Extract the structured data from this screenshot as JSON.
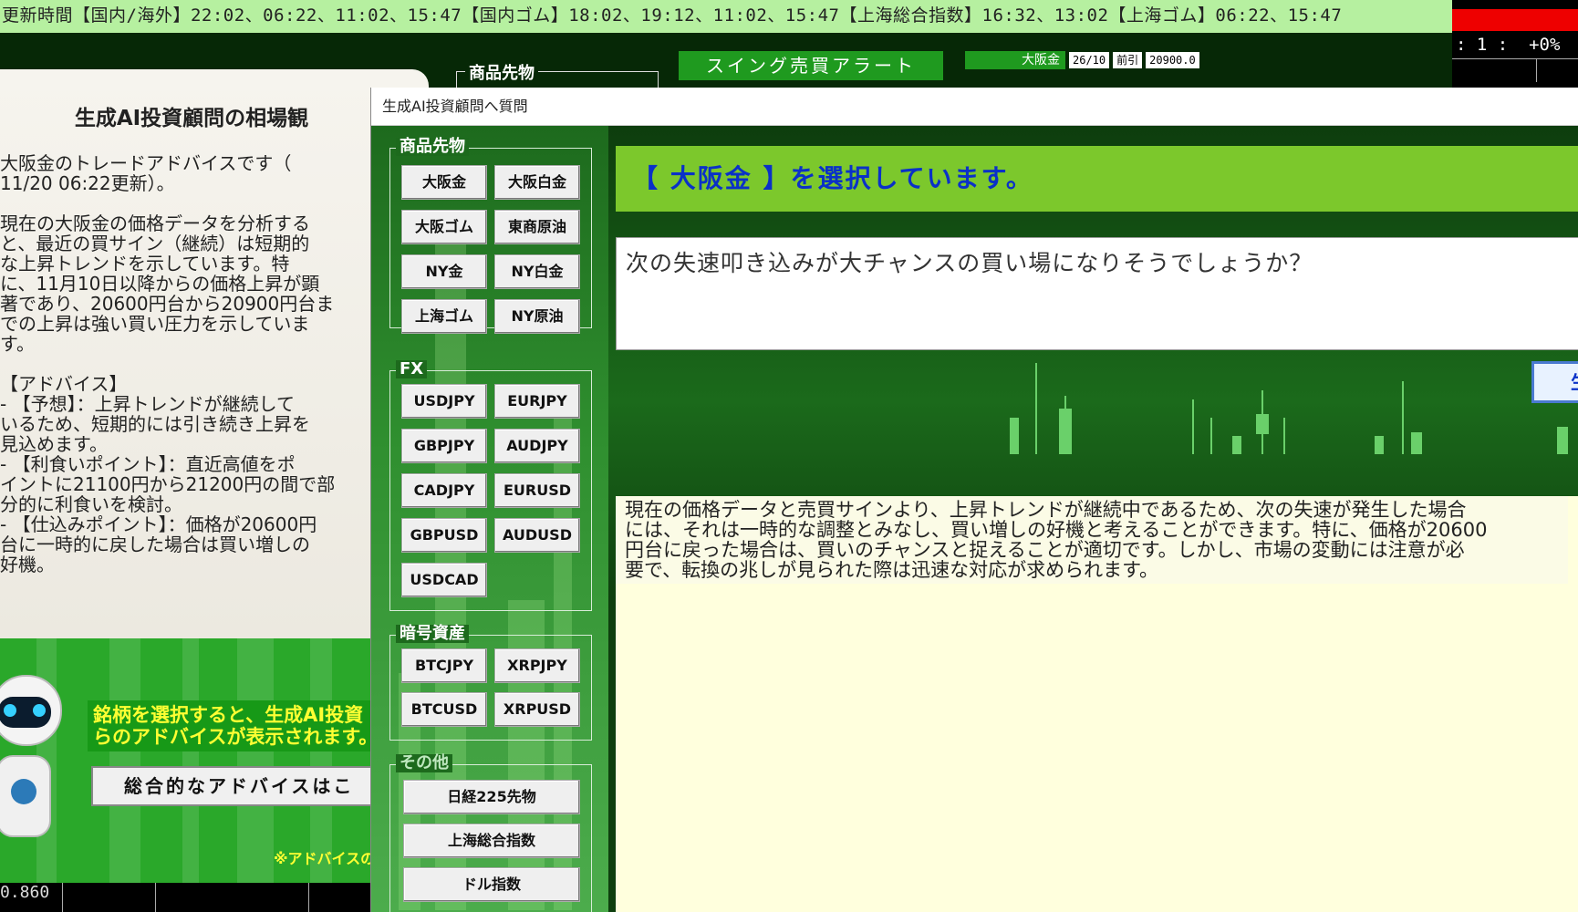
{
  "ticker": {
    "text": "更新時間【国内/海外】22:02、06:22、11:02、15:47【国内ゴム】18:02、19:12、11:02、15:47【上海総合指数】16:32、13:02【上海ゴム】06:22、15:47"
  },
  "top_right": {
    "value": ": 1 :  +0%"
  },
  "background_app": {
    "group_label": "商品先物",
    "swing_alert": "スイング売買アラート",
    "quote": {
      "name": "大阪金",
      "month": "26/10",
      "prev_label": "前引",
      "price": "20900.0"
    }
  },
  "advice_panel": {
    "title": "生成AI投資顧問の相場観",
    "body": "大阪金のトレードアドバイスです（\n11/20 06:22更新）。\n\n現在の大阪金の価格データを分析する\nと、最近の買サイン（継続）は短期的\nな上昇トレンドを示しています。特\nに、11月10日以降からの価格上昇が顕\n著であり、20600円台から20900円台ま\nでの上昇は強い買い圧力を示していま\nす。\n\n【アドバイス】\n- 【予想】：上昇トレンドが継続して\nいるため、短期的には引き続き上昇を\n見込めます。\n- 【利食いポイント】：直近高値をポ\nイントに21100円から21200円の間で部\n分的に利食いを検討。\n- 【仕込みポイント】：価格が20600円\n台に一時的に戻した場合は買い増しの\n好機。"
  },
  "promo": {
    "message": "銘柄を選択すると、生成AI投資\nらのアドバイスが表示されます。",
    "button": "総合的なアドバイスはこ",
    "note": "※アドバイスの"
  },
  "bottom_left": {
    "value": "0.860"
  },
  "dialog": {
    "title": "生成AI投資顧問へ質問",
    "groups": [
      {
        "label": "商品先物",
        "buttons": [
          "大阪金",
          "大阪白金",
          "大阪ゴム",
          "東商原油",
          "NY金",
          "NY白金",
          "上海ゴム",
          "NY原油"
        ]
      },
      {
        "label": "FX",
        "buttons": [
          "USDJPY",
          "EURJPY",
          "GBPJPY",
          "AUDJPY",
          "CADJPY",
          "EURUSD",
          "GBPUSD",
          "AUDUSD",
          "USDCAD"
        ]
      },
      {
        "label": "暗号資産",
        "buttons": [
          "BTCJPY",
          "XRPJPY",
          "BTCUSD",
          "XRPUSD"
        ]
      },
      {
        "label": "その他",
        "buttons": [
          "日経225先物",
          "上海総合指数",
          "ドル指数"
        ]
      }
    ],
    "selected_text": "【 大阪金 】を選択しています。",
    "question": "次の失速叩き込みが大チャンスの買い場になりそうでしょうか？",
    "ask_button": "生成AI投資顧問に質問",
    "answer": "現在の価格データと売買サインより、上昇トレンドが継続中であるため、次の失速が発生した場合\nには、それは一時的な調整とみなし、買い増しの好機と考えることができます。特に、価格が20600\n円台に戻った場合は、買いのチャンスと捉えることが適切です。しかし、市場の変動には注意が必\n要で、転換の兆しが見られた際は迅速な対応が求められます。"
  },
  "colors": {
    "ticker_bg": "#b6f0a0",
    "selected_bar": "#7cc82c",
    "selected_text": "#0a31c8",
    "answer_bg": "#ffffdd",
    "promo_text": "#ffff33"
  }
}
